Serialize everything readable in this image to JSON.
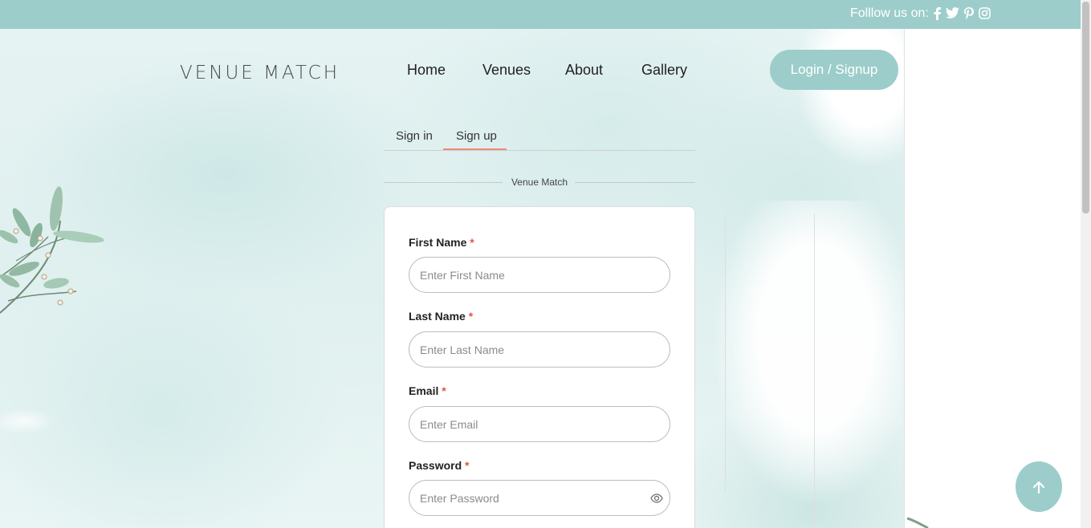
{
  "topbar": {
    "follow_label": "Folllow us on:",
    "social_icons": [
      "facebook-icon",
      "twitter-icon",
      "pinterest-icon",
      "instagram-icon"
    ]
  },
  "header": {
    "logo": "VENUE MATCH",
    "nav": [
      "Home",
      "Venues",
      "About",
      "Gallery"
    ],
    "login_label": "Login / Signup"
  },
  "auth": {
    "tabs": [
      "Sign in",
      "Sign up"
    ],
    "active_tab": "Sign up",
    "divider_label": "Venue Match",
    "fields": [
      {
        "label": "First Name",
        "required_mark": "*",
        "placeholder": "Enter First Name",
        "value": ""
      },
      {
        "label": "Last Name",
        "required_mark": "*",
        "placeholder": "Enter Last Name",
        "value": ""
      },
      {
        "label": "Email",
        "required_mark": "*",
        "placeholder": "Enter Email",
        "value": ""
      },
      {
        "label": "Password",
        "required_mark": "*",
        "placeholder": "Enter Password",
        "value": ""
      }
    ]
  },
  "colors": {
    "accent": "#9ccdca",
    "tab_underline": "#f08a76",
    "required": "#e0584b"
  },
  "back_to_top_icon": "arrow-up-icon"
}
